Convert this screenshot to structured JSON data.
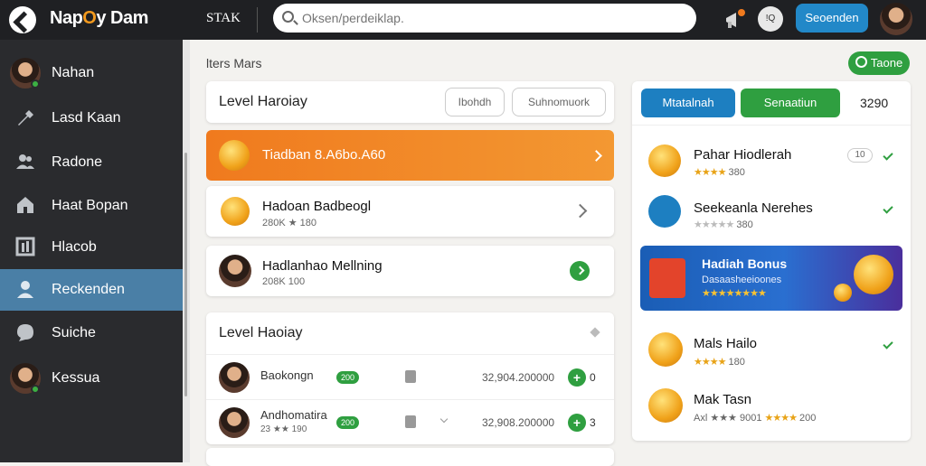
{
  "topbar": {
    "brand_a": "Nap",
    "brand_o": "O",
    "brand_b": "y Dam",
    "stak": "STAK",
    "search_placeholder": "Oksen/perdeiklap.",
    "q_label": "!Q",
    "action_button": "Seoenden"
  },
  "sidebar": {
    "items": [
      {
        "label": "Nahan"
      },
      {
        "label": "Lasd Kaan"
      },
      {
        "label": "Radone"
      },
      {
        "label": "Haat Bopan"
      },
      {
        "label": "Hlacob"
      },
      {
        "label": "Reckenden"
      },
      {
        "label": "Suiche"
      },
      {
        "label": "Kessua"
      }
    ]
  },
  "main": {
    "breadcrumb": "lters Mars",
    "filter_pill": "Taone",
    "level_card": {
      "title": "Level Haroiay",
      "btn1": "Ibohdh",
      "btn2": "Suhnomuork"
    },
    "highlight": {
      "title": "Tiadban 8.A6bo.A60"
    },
    "rows": [
      {
        "title": "Hadoan Badbeogl",
        "sub": "280K ★ 180"
      },
      {
        "title": "Hadlanhao Mellning",
        "sub": "208K 100"
      }
    ],
    "list": {
      "title": "Level Haoiay",
      "items": [
        {
          "name": "Baokongn",
          "sub": "",
          "badge": "200",
          "num": "32,904.200000",
          "count": "0"
        },
        {
          "name": "Andhomatira",
          "sub": "23 ★★ 190",
          "badge": "200",
          "num": "32,908.200000",
          "count": "3"
        }
      ]
    }
  },
  "right": {
    "btn_blue": "Mtatalnah",
    "btn_green": "Senaatiun",
    "count": "3290",
    "items": [
      {
        "title": "Pahar Hiodlerah",
        "stars": "★★★★",
        "sub": "380",
        "pill": "10"
      },
      {
        "title": "Seekeanla Nerehes",
        "stars": "★★★★★",
        "sub": "380"
      },
      {
        "title": "Mals Hailo",
        "stars": "★★★★",
        "sub": "180"
      },
      {
        "title": "Mak Tasn",
        "stars": "★★★★",
        "sub": "200",
        "prefix": "Axl ★★★ 9001"
      }
    ],
    "banner": {
      "title": "Hadiah Bonus",
      "sub": "Dasaasheeioones",
      "stars": "★★★★★★★★"
    }
  },
  "colors": {
    "topbar": "#1f2023",
    "sidebar": "#2a2b2e",
    "active": "#4a7fa6",
    "orange": "#f07a1e",
    "green": "#2f9f40",
    "blue": "#1d7fc1"
  }
}
